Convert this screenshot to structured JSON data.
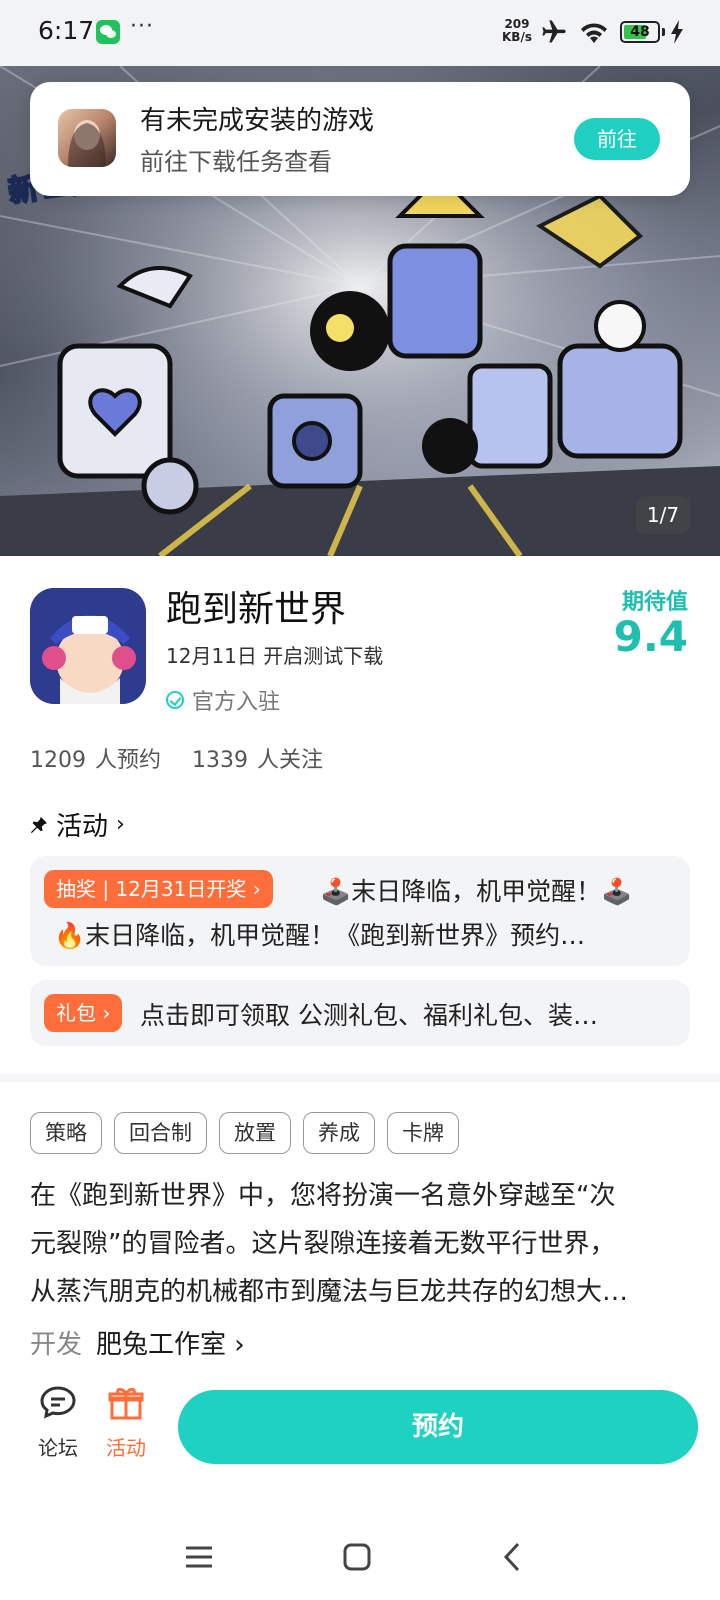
{
  "status_bar": {
    "time": "6:17",
    "more": "···",
    "net_speed_value": "209",
    "net_speed_unit": "KB/s",
    "battery": "48"
  },
  "notice": {
    "title": "有未完成安装的游戏",
    "subtitle": "前往下载任务查看",
    "button": "前往"
  },
  "banner": {
    "counter": "1/7"
  },
  "game": {
    "title": "跑到新世界",
    "date": "12月11日 开启测试下载",
    "official": "官方入驻",
    "score_label": "期待值",
    "score": "9.4",
    "reservations": "1209 人预约",
    "followers": "1339 人关注"
  },
  "activity": {
    "heading": "活动",
    "chevron": "›",
    "tag": "抽奖 | 12月31日开奖 ›",
    "line1": "🕹️末日降临，机甲觉醒！🕹️",
    "line2": "🔥末日降临，机甲觉醒！《跑到新世界》预约…"
  },
  "gift": {
    "tag": "礼包 ›",
    "text": "点击即可领取 公测礼包、福利礼包、装…"
  },
  "tags": [
    "策略",
    "回合制",
    "放置",
    "养成",
    "卡牌"
  ],
  "description": {
    "line1": "在《跑到新世界》中，您将扮演一名意外穿越至“次",
    "line2": "元裂隙”的冒险者。这片裂隙连接着无数平行世界，",
    "line3": "从蒸汽朋克的机械都市到魔法与巨龙共存的幻想大…"
  },
  "developer": {
    "label": "开发",
    "name": "肥兔工作室 ›"
  },
  "bottom_bar": {
    "forum": "论坛",
    "activity": "活动",
    "reserve": "预约"
  },
  "colors": {
    "accent": "#1fd1c1",
    "orange": "#ff6d3a"
  }
}
